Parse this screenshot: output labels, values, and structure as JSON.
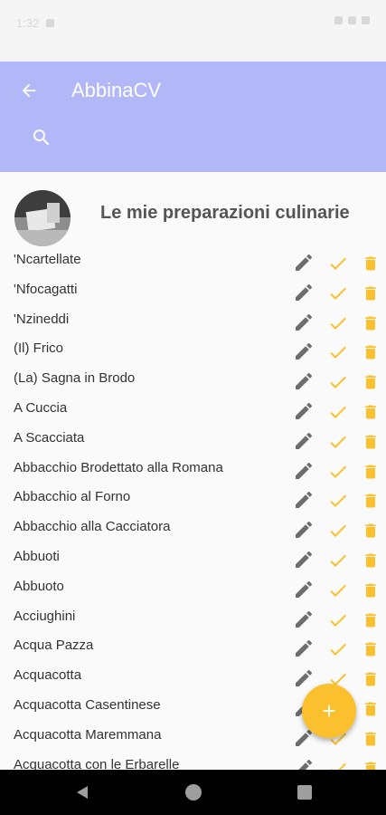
{
  "status_bar": {
    "time": "1:32"
  },
  "app_bar": {
    "title": "AbbinaCV",
    "back_icon": "arrow-back-icon",
    "search_icon": "search-icon",
    "background_color": "#b2b7f7"
  },
  "header": {
    "title": "Le mie preparazioni culinarie",
    "avatar_icon": "avatar"
  },
  "recipes": [
    "'Ncartellate",
    "'Nfocagatti",
    "'Nzineddi",
    "(Il) Frico",
    "(La) Sagna in Brodo",
    "A Cuccia",
    "A Scacciata",
    "Abbacchio Brodettato alla Romana",
    "Abbacchio al Forno",
    "Abbacchio alla Cacciatora",
    "Abbuoti",
    "Abbuoto",
    "Acciughini",
    "Acqua Pazza",
    "Acquacotta",
    "Acquacotta Casentinese",
    "Acquacotta Maremmana",
    "Acquacotta con le Erbarelle"
  ],
  "row_icons": {
    "edit": "pencil-icon",
    "confirm": "check-icon",
    "delete": "trash-icon",
    "edit_color": "#6d6d6d",
    "accent_color": "#fbc02d"
  },
  "fab": {
    "icon": "plus-icon",
    "label": "+"
  },
  "nav_bar": {
    "back": "nav-back-icon",
    "home": "nav-home-icon",
    "recents": "nav-recents-icon"
  }
}
